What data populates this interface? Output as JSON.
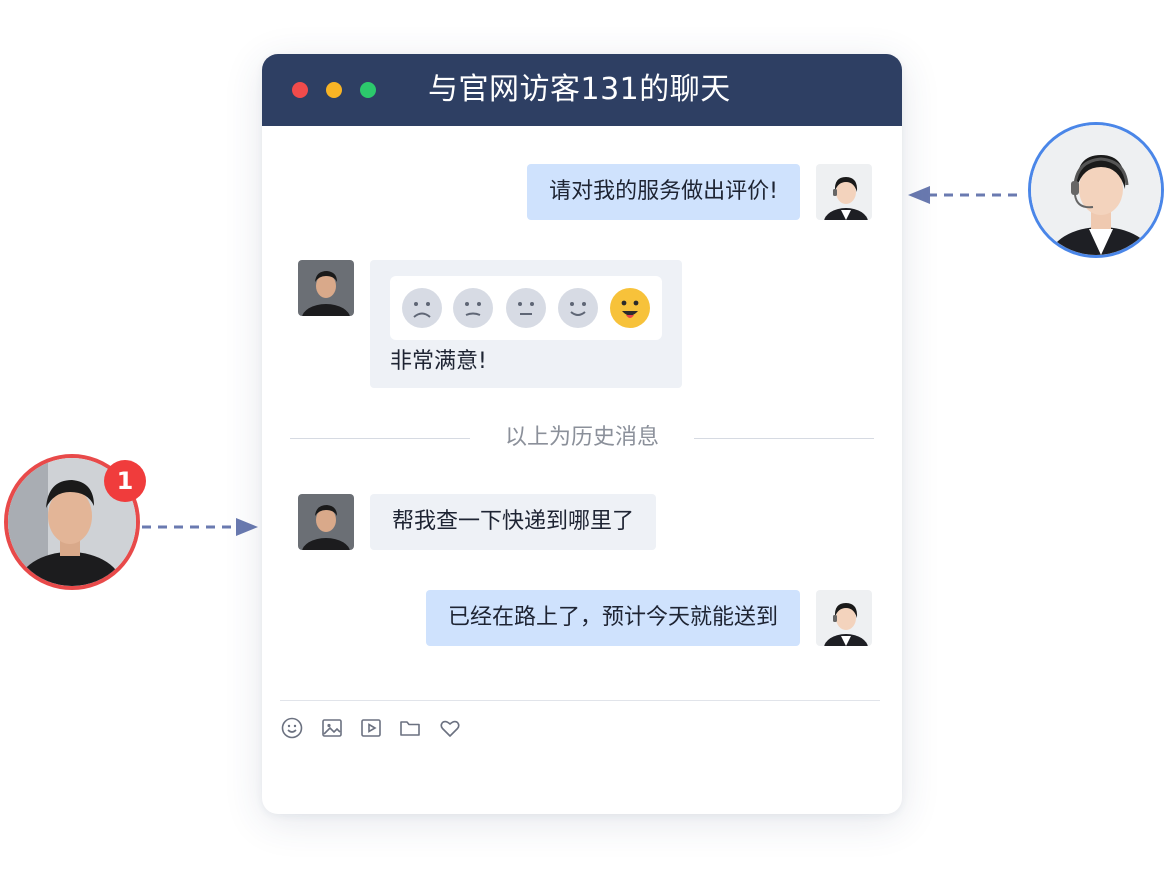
{
  "window": {
    "title": "与官网访客131的聊天"
  },
  "messages": [
    {
      "sender": "agent",
      "text": "请对我的服务做出评价!"
    },
    {
      "sender": "visitor",
      "type": "rating",
      "selected_rating": 5,
      "max_rating": 5,
      "text": "非常满意!"
    },
    {
      "sender": "visitor",
      "text": "帮我查一下快递到哪里了"
    },
    {
      "sender": "agent",
      "text": "已经在路上了，预计今天就能送到"
    }
  ],
  "history_divider": "以上为历史消息",
  "visitor_badge": "1",
  "toolbar": {
    "icons": [
      "emoji-icon",
      "image-icon",
      "video-icon",
      "folder-icon",
      "heart-icon"
    ]
  },
  "colors": {
    "titlebar": "#2e3f63",
    "agent_bubble": "#cfe2fd",
    "visitor_bubble": "#eef1f6",
    "badge": "#f03c3c",
    "agent_ring": "#4a86e8",
    "visitor_ring": "#e84a4a"
  }
}
